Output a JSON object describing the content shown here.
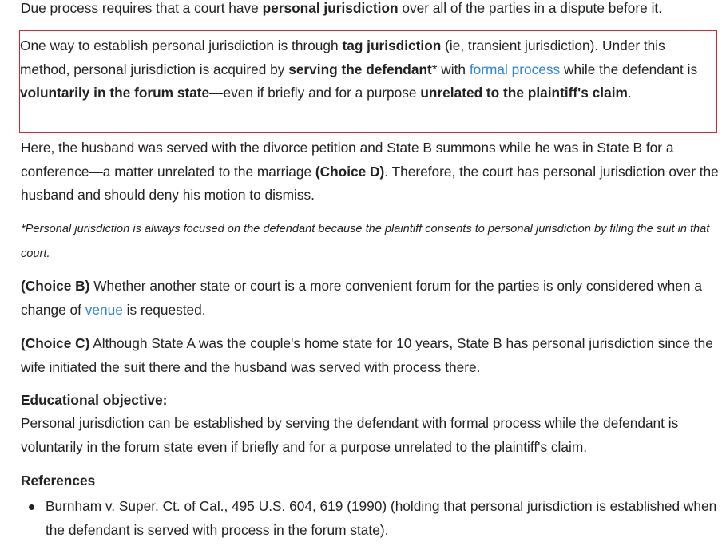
{
  "p1": {
    "t1": "Due process requires that a court have ",
    "b1": "personal jurisdiction",
    "t2": " over all of the parties in a dispute before it."
  },
  "box": {
    "t1": "One way to establish personal jurisdiction is through ",
    "b1": "tag jurisdiction",
    "t2": " (ie, transient jurisdiction).  Under this method, personal jurisdiction is acquired by ",
    "b2": "serving the defendant",
    "t3": "* with ",
    "link1": "formal process",
    "t4": " while the defendant is ",
    "b3": "voluntarily in the forum state",
    "t5": "—even if briefly and for a purpose ",
    "b4": "unrelated to the plaintiff's claim",
    "t6": "."
  },
  "p3": {
    "t1": "Here, the husband was served with the divorce petition and State B summons while he was in State B for a conference—a matter unrelated to the marriage ",
    "b1": "(Choice D)",
    "t2": ".  Therefore, the court has personal jurisdiction over the husband and should deny his motion to dismiss."
  },
  "footnote": "*Personal jurisdiction is always focused on the defendant because the plaintiff consents to personal jurisdiction by filing the suit in that court.",
  "choice_b": {
    "label": "(Choice B)",
    "t1": "  Whether another state or court is a more convenient forum for the parties is only considered when a change of ",
    "link1": "venue",
    "t2": " is requested."
  },
  "choice_c": {
    "label": "(Choice C)",
    "t1": "  Although State A was the couple's home state for 10 years, State B has personal jurisdiction since the wife initiated the suit there and the husband was served with process there."
  },
  "objective": {
    "heading": "Educational objective:",
    "text": "Personal jurisdiction can be established by serving the defendant with formal process while the defendant is voluntarily in the forum state even if briefly and for a purpose unrelated to the plaintiff's claim."
  },
  "references": {
    "heading": "References",
    "items": [
      "Burnham v. Super. Ct. of Cal., 495 U.S. 604, 619 (1990) (holding that personal jurisdiction is established when the defendant is served with process in the forum state)."
    ]
  },
  "colors": {
    "text": "#222222",
    "link": "#2f86d6",
    "highlight_border": "#d9262e"
  }
}
